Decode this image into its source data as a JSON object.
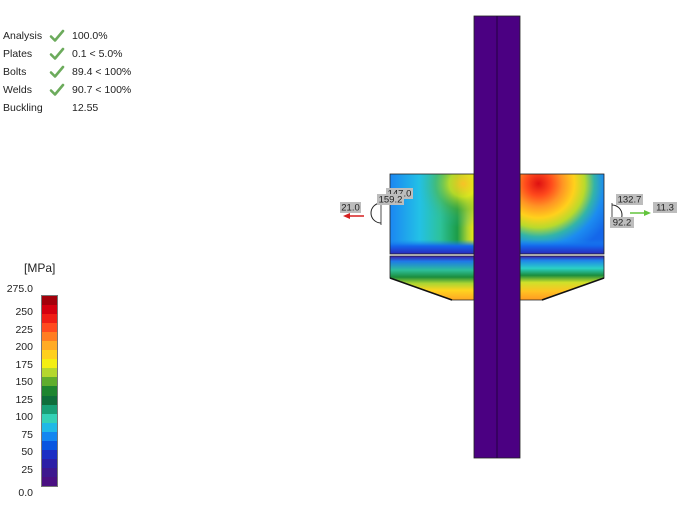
{
  "summary": {
    "rows": [
      {
        "label": "Analysis",
        "check": true,
        "value": "100.0%"
      },
      {
        "label": "Plates",
        "check": true,
        "value": "0.1 < 5.0%"
      },
      {
        "label": "Bolts",
        "check": true,
        "value": "89.4 < 100%"
      },
      {
        "label": "Welds",
        "check": true,
        "value": "90.7 < 100%"
      },
      {
        "label": "Buckling",
        "check": false,
        "value": "12.55"
      }
    ]
  },
  "colors": {
    "check": "#6cab5c",
    "member": "#4b0082",
    "force_left": "#d61f1f",
    "force_right": "#62c43c"
  },
  "legend": {
    "unit": "[MPa]",
    "ticks": [
      "275.0",
      "250",
      "225",
      "200",
      "175",
      "150",
      "125",
      "100",
      "75",
      "50",
      "25",
      "0.0"
    ],
    "colors": [
      "#a3000b",
      "#d4000f",
      "#ef1d15",
      "#ff4a1f",
      "#ff7d22",
      "#ffab26",
      "#ffd01e",
      "#f4ee13",
      "#b4d72e",
      "#5fad2d",
      "#1e8530",
      "#0e6e3b",
      "#18a076",
      "#34d1b6",
      "#20b9e6",
      "#1386f0",
      "#0755e0",
      "#1c2ec4",
      "#2c1fa6",
      "#3d188e",
      "#4a1082"
    ]
  },
  "model": {
    "labels": {
      "l_top": "147.0",
      "l_mid": "159.2",
      "l_force": "21.0",
      "r_top": "132.7",
      "r_bot": "92.2",
      "r_force": "11.3"
    }
  }
}
